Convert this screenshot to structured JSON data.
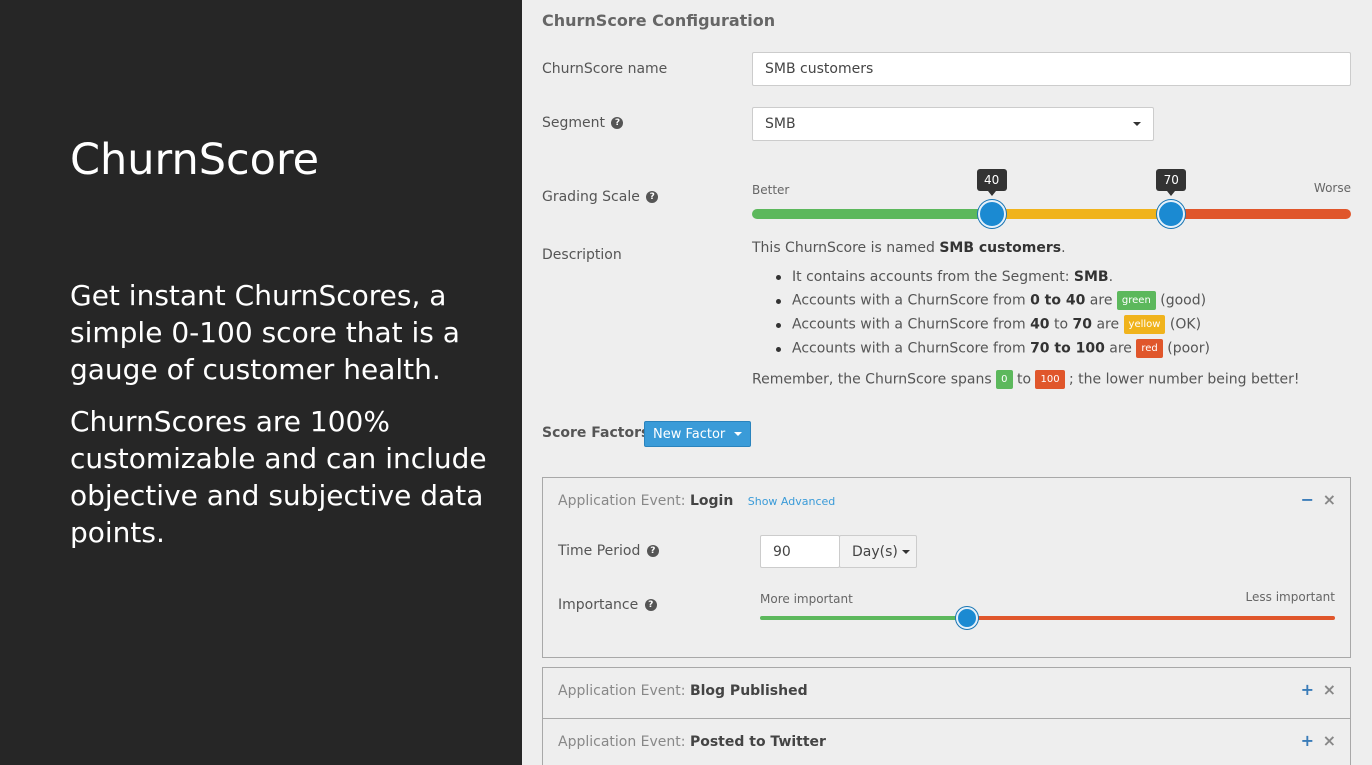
{
  "slide": {
    "title": "ChurnScore",
    "para1": "Get instant ChurnScores, a simple 0-100 score that is a gauge of customer health.",
    "para2": "ChurnScores are 100% customizable and can include objective and subjective data points."
  },
  "config": {
    "title": "ChurnScore Configuration",
    "name_label": "ChurnScore name",
    "name_value": "SMB customers",
    "segment_label": "Segment",
    "segment_value": "SMB",
    "grading_label": "Grading Scale",
    "grading": {
      "left_label": "Better",
      "right_label": "Worse",
      "low": 40,
      "high": 70,
      "low_label": "40",
      "high_label": "70",
      "min": 0,
      "max": 100
    },
    "description_label": "Description",
    "description": {
      "intro_pre": "This ChurnScore is named ",
      "intro_name": "SMB customers",
      "intro_post": ".",
      "segment_pre": "It contains accounts from the Segment: ",
      "segment_name": "SMB",
      "segment_post": ".",
      "green_pre": "Accounts with a ChurnScore from ",
      "green_range": "0 to 40",
      "green_are": " are ",
      "green_badge": "green",
      "green_note": " (good)",
      "yellow_pre": "Accounts with a ChurnScore from ",
      "yellow_from": "40",
      "yellow_to": " to ",
      "yellow_end": "70",
      "yellow_are": " are ",
      "yellow_badge": "yellow",
      "yellow_note": " (OK)",
      "red_pre": "Accounts with a ChurnScore from ",
      "red_range": "70 to 100",
      "red_are": " are ",
      "red_badge": "red",
      "red_note": " (poor)",
      "remember_pre": "Remember, the ChurnScore spans ",
      "remember_min": "0",
      "remember_to": " to ",
      "remember_max": "100",
      "remember_post": " ; the lower number being better!"
    },
    "factors_label": "Score Factors",
    "new_factor_label": "New Factor"
  },
  "factors": [
    {
      "prefix": "Application Event: ",
      "name": "Login",
      "show_advanced": "Show Advanced",
      "time_period_label": "Time Period",
      "time_period_value": "90",
      "time_unit": "Day(s)",
      "importance_label": "Importance",
      "importance_left": "More important",
      "importance_right": "Less important",
      "importance_value": 36,
      "collapse_icon": "minus-icon",
      "close_icon": "close-icon"
    },
    {
      "prefix": "Application Event: ",
      "name": "Blog Published",
      "expand_icon": "plus-icon",
      "close_icon": "close-icon"
    },
    {
      "prefix": "Application Event: ",
      "name": "Posted to Twitter",
      "expand_icon": "plus-icon",
      "close_icon": "close-icon"
    }
  ],
  "colors": {
    "good": "#5cb85c",
    "ok": "#f0b31c",
    "poor": "#e0562b",
    "accent": "#3a9bd8"
  }
}
